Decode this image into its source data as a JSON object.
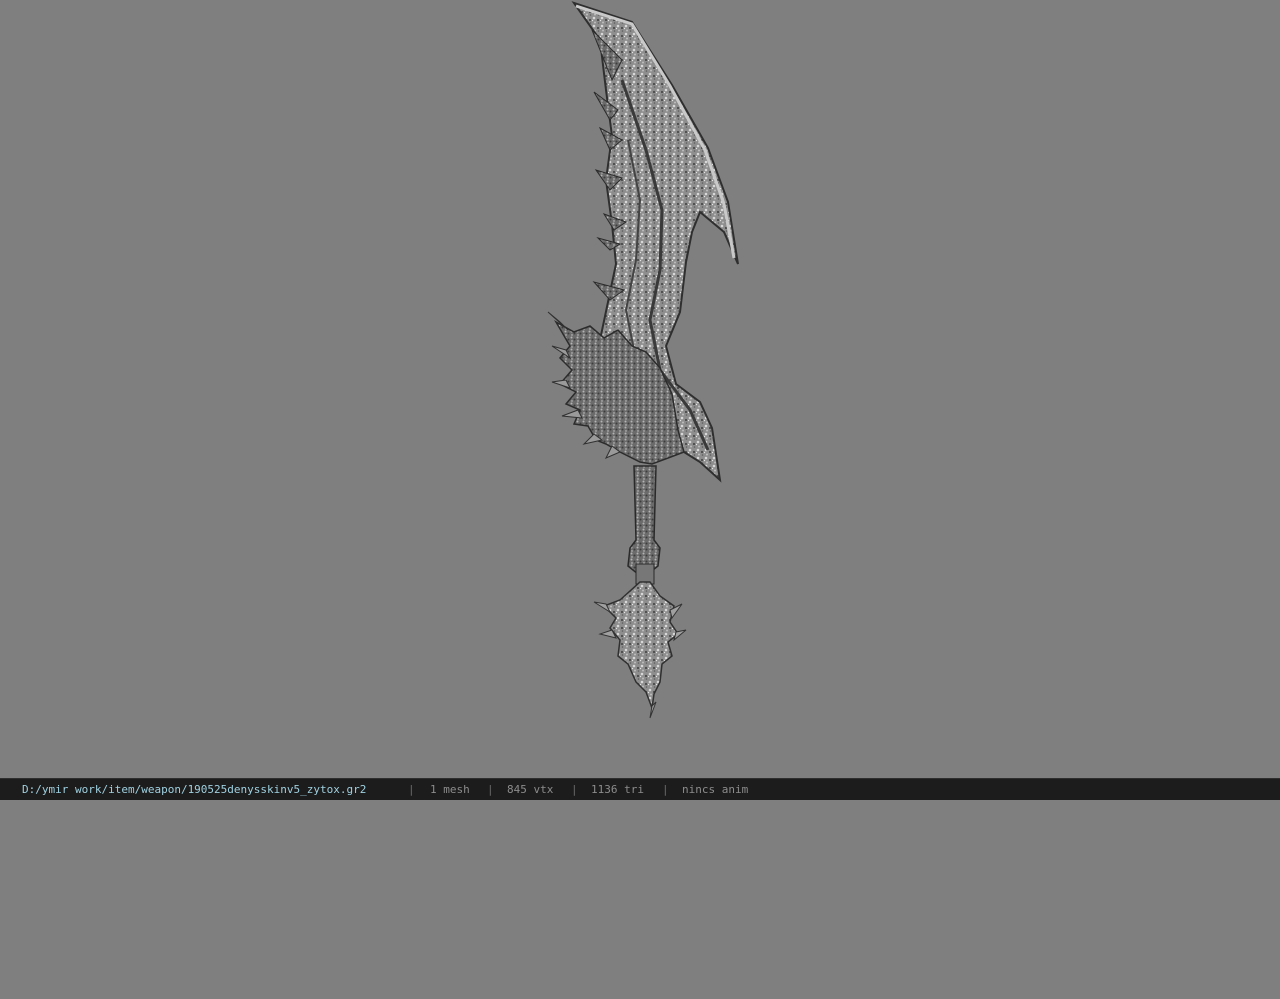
{
  "viewport": {
    "background_color": "#7f7f7f",
    "model_name": "sword-model"
  },
  "status": {
    "path": "D:/ymir work/item/weapon/190525denysskinv5_zytox.gr2",
    "mesh": "1 mesh",
    "vtx": "845 vtx",
    "tri": "1136 tri",
    "anim": "nincs anim",
    "separator": "|"
  },
  "colors": {
    "statusbar_bg": "#1c1c1c",
    "path_text": "#9fd0e0",
    "info_text": "#8c8c8c"
  }
}
